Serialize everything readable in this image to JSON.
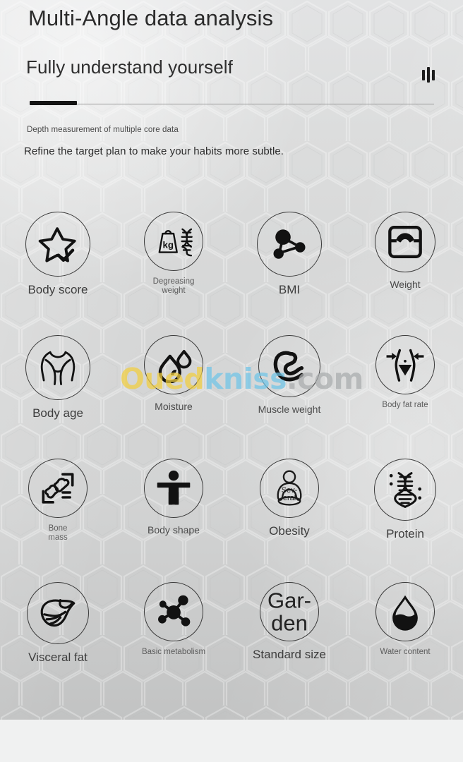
{
  "header": {
    "title": "Multi-Angle data analysis",
    "subtitle": "Fully understand yourself",
    "caption": "Depth measurement of multiple core data",
    "tagline": "Refine the target plan to make your habits more subtle.",
    "eq_icon": "equalizer-icon",
    "progress_percent": 12
  },
  "watermark": {
    "part1": "Oued",
    "part2": "kniss",
    "part3": ".com",
    "color1": "#f2cf3f",
    "color2": "#6fc5e8",
    "color3": "#a9acad"
  },
  "colors": {
    "background": "#d6d7d7",
    "stroke": "#3a3a3a",
    "ink": "#1b1b1b",
    "label": "#4a4a4a",
    "accent": "#141414"
  },
  "grid": {
    "columns": 4,
    "items": [
      {
        "label": "Body score",
        "icon": "star-check-icon",
        "size": "lg",
        "circle": 92,
        "inner_text": ""
      },
      {
        "label": "Degreasing\nweight",
        "icon": "kg-weight-dna-icon",
        "size": "sm",
        "circle": 84,
        "inner_text": "kg"
      },
      {
        "label": "BMI",
        "icon": "molecule-triangle-icon",
        "size": "lg",
        "circle": 92,
        "inner_text": ""
      },
      {
        "label": "Weight",
        "icon": "bathroom-scale-icon",
        "size": "md",
        "circle": 86,
        "inner_text": ""
      },
      {
        "label": "Body age",
        "icon": "torso-body-icon",
        "size": "lg",
        "circle": 92,
        "inner_text": ""
      },
      {
        "label": "Moisture",
        "icon": "water-droplets-icon",
        "size": "md",
        "circle": 84,
        "inner_text": ""
      },
      {
        "label": "Muscle weight",
        "icon": "flexed-biceps-icon",
        "size": "md",
        "circle": 88,
        "inner_text": ""
      },
      {
        "label": "Body fat rate",
        "icon": "waist-arrows-icon",
        "size": "sm",
        "circle": 84,
        "inner_text": ""
      },
      {
        "label": "Bone\nmass",
        "icon": "bone-xray-icon",
        "size": "sm",
        "circle": 84,
        "inner_text": ""
      },
      {
        "label": "Body shape",
        "icon": "person-arms-out-icon",
        "size": "md",
        "circle": 84,
        "inner_text": ""
      },
      {
        "label": "Obesity",
        "icon": "obese-person-icon",
        "size": "lg",
        "circle": 84,
        "inner_text": "Sev-\neral"
      },
      {
        "label": "Protein",
        "icon": "dna-helix-icon",
        "size": "lg",
        "circle": 88,
        "inner_text": ""
      },
      {
        "label": "Visceral fat",
        "icon": "liver-organ-icon",
        "size": "lg",
        "circle": 88,
        "inner_text": ""
      },
      {
        "label": "Basic metabolism",
        "icon": "atom-molecule-icon",
        "size": "sm",
        "circle": 84,
        "inner_text": ""
      },
      {
        "label": "Standard size",
        "icon": "garden-text-icon",
        "size": "lg",
        "circle": 84,
        "inner_text": "Gar-\nden"
      },
      {
        "label": "Water content",
        "icon": "filled-droplet-icon",
        "size": "sm",
        "circle": 84,
        "inner_text": ""
      }
    ]
  }
}
